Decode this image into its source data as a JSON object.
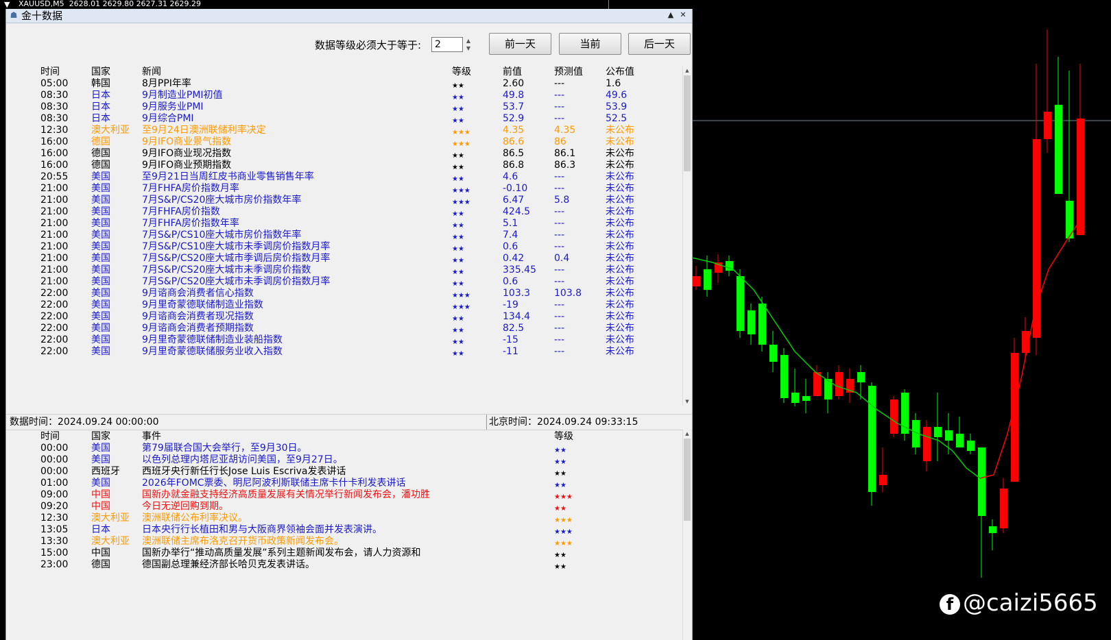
{
  "topbar": {
    "symbol_line": "XAUUSD,M5  2628.01 2629.80 2627.31 2629.29"
  },
  "window": {
    "title": "金十数据",
    "minimize": "▲",
    "close": "✕"
  },
  "filter": {
    "label": "数据等级必须大于等于:",
    "value": "2"
  },
  "buttons": {
    "prev": "前一天",
    "current": "当前",
    "next": "后一天"
  },
  "data_table": {
    "headers": {
      "time": "时间",
      "country": "国家",
      "news": "新闻",
      "level": "等级",
      "prev": "前值",
      "forecast": "预测值",
      "actual": "公布值"
    },
    "rows": [
      {
        "time": "05:00",
        "country": "韩国",
        "news": "8月PPI年率",
        "level": "★★",
        "prev": "2.60",
        "forecast": "---",
        "actual": "1.6",
        "color": "#000000"
      },
      {
        "time": "08:30",
        "country": "日本",
        "news": "9月制造业PMI初值",
        "level": "★★",
        "prev": "49.8",
        "forecast": "---",
        "actual": "49.6",
        "color": "#1a1acc"
      },
      {
        "time": "08:30",
        "country": "日本",
        "news": "9月服务业PMI",
        "level": "★★",
        "prev": "53.7",
        "forecast": "---",
        "actual": "53.9",
        "color": "#1a1acc"
      },
      {
        "time": "08:30",
        "country": "日本",
        "news": "9月综合PMI",
        "level": "★★",
        "prev": "52.9",
        "forecast": "---",
        "actual": "52.5",
        "color": "#1a1acc"
      },
      {
        "time": "12:30",
        "country": "澳大利亚",
        "news": "至9月24日澳洲联储利率决定",
        "level": "★★★",
        "prev": "4.35",
        "forecast": "4.35",
        "actual": "未公布",
        "color": "#ff9900"
      },
      {
        "time": "16:00",
        "country": "德国",
        "news": "9月IFO商业景气指数",
        "level": "★★★",
        "prev": "86.6",
        "forecast": "86",
        "actual": "未公布",
        "color": "#ff9900"
      },
      {
        "time": "16:00",
        "country": "德国",
        "news": "9月IFO商业现况指数",
        "level": "★★",
        "prev": "86.5",
        "forecast": "86.1",
        "actual": "未公布",
        "color": "#000000"
      },
      {
        "time": "16:00",
        "country": "德国",
        "news": "9月IFO商业预期指数",
        "level": "★★",
        "prev": "86.8",
        "forecast": "86.3",
        "actual": "未公布",
        "color": "#000000"
      },
      {
        "time": "20:55",
        "country": "美国",
        "news": "至9月21日当周红皮书商业零售销售年率",
        "level": "★★",
        "prev": "4.6",
        "forecast": "---",
        "actual": "未公布",
        "color": "#1a1acc"
      },
      {
        "time": "21:00",
        "country": "美国",
        "news": "7月FHFA房价指数月率",
        "level": "★★★",
        "prev": "-0.10",
        "forecast": "---",
        "actual": "未公布",
        "color": "#1a1acc"
      },
      {
        "time": "21:00",
        "country": "美国",
        "news": "7月S&P/CS20座大城市房价指数年率",
        "level": "★★★",
        "prev": "6.47",
        "forecast": "5.8",
        "actual": "未公布",
        "color": "#1a1acc"
      },
      {
        "time": "21:00",
        "country": "美国",
        "news": "7月FHFA房价指数",
        "level": "★★",
        "prev": "424.5",
        "forecast": "---",
        "actual": "未公布",
        "color": "#1a1acc"
      },
      {
        "time": "21:00",
        "country": "美国",
        "news": "7月FHFA房价指数年率",
        "level": "★★",
        "prev": "5.1",
        "forecast": "---",
        "actual": "未公布",
        "color": "#1a1acc"
      },
      {
        "time": "21:00",
        "country": "美国",
        "news": "7月S&P/CS10座大城市房价指数年率",
        "level": "★★",
        "prev": "7.4",
        "forecast": "---",
        "actual": "未公布",
        "color": "#1a1acc"
      },
      {
        "time": "21:00",
        "country": "美国",
        "news": "7月S&P/CS10座大城市未季调房价指数月率",
        "level": "★★",
        "prev": "0.6",
        "forecast": "---",
        "actual": "未公布",
        "color": "#1a1acc"
      },
      {
        "time": "21:00",
        "country": "美国",
        "news": "7月S&P/CS20座大城市季调后房价指数月率",
        "level": "★★",
        "prev": "0.42",
        "forecast": "0.4",
        "actual": "未公布",
        "color": "#1a1acc"
      },
      {
        "time": "21:00",
        "country": "美国",
        "news": "7月S&P/CS20座大城市未季调房价指数",
        "level": "★★",
        "prev": "335.45",
        "forecast": "---",
        "actual": "未公布",
        "color": "#1a1acc"
      },
      {
        "time": "21:00",
        "country": "美国",
        "news": "7月S&P/CS20座大城市未季调房价指数月率",
        "level": "★★",
        "prev": "0.6",
        "forecast": "---",
        "actual": "未公布",
        "color": "#1a1acc"
      },
      {
        "time": "22:00",
        "country": "美国",
        "news": "9月谘商会消费者信心指数",
        "level": "★★★",
        "prev": "103.3",
        "forecast": "103.8",
        "actual": "未公布",
        "color": "#1a1acc"
      },
      {
        "time": "22:00",
        "country": "美国",
        "news": "9月里奇蒙德联储制造业指数",
        "level": "★★★",
        "prev": "-19",
        "forecast": "---",
        "actual": "未公布",
        "color": "#1a1acc"
      },
      {
        "time": "22:00",
        "country": "美国",
        "news": "9月谘商会消费者现况指数",
        "level": "★★",
        "prev": "134.4",
        "forecast": "---",
        "actual": "未公布",
        "color": "#1a1acc"
      },
      {
        "time": "22:00",
        "country": "美国",
        "news": "9月谘商会消费者预期指数",
        "level": "★★",
        "prev": "82.5",
        "forecast": "---",
        "actual": "未公布",
        "color": "#1a1acc"
      },
      {
        "time": "22:00",
        "country": "美国",
        "news": "9月里奇蒙德联储制造业装船指数",
        "level": "★★",
        "prev": "-15",
        "forecast": "---",
        "actual": "未公布",
        "color": "#1a1acc"
      },
      {
        "time": "22:00",
        "country": "美国",
        "news": "9月里奇蒙德联储服务业收入指数",
        "level": "★★",
        "prev": "-11",
        "forecast": "---",
        "actual": "未公布",
        "color": "#1a1acc"
      }
    ]
  },
  "status": {
    "data_time_label": "数据时间：2024.09.24 00:00:00",
    "beijing_time_label": "北京时间：2024.09.24 09:33:15"
  },
  "event_table": {
    "headers": {
      "time": "时间",
      "country": "国家",
      "event": "事件",
      "level": "等级"
    },
    "rows": [
      {
        "time": "00:00",
        "country": "美国",
        "event": "第79届联合国大会举行，至9月30日。",
        "level": "★★",
        "color": "#1a1acc"
      },
      {
        "time": "00:00",
        "country": "美国",
        "event": "以色列总理内塔尼亚胡访问美国，至9月27日。",
        "level": "★★",
        "color": "#1a1acc"
      },
      {
        "time": "00:00",
        "country": "西班牙",
        "event": "西班牙央行新任行长Jose Luis Escriva发表讲话",
        "level": "★★",
        "color": "#000000"
      },
      {
        "time": "01:00",
        "country": "美国",
        "event": "2026年FOMC票委、明尼阿波利斯联储主席卡什卡利发表讲话",
        "level": "★★",
        "color": "#1a1acc"
      },
      {
        "time": "09:00",
        "country": "中国",
        "event": "国新办就金融支持经济高质量发展有关情况举行新闻发布会，潘功胜",
        "level": "★★★",
        "color": "#ee1111"
      },
      {
        "time": "09:20",
        "country": "中国",
        "event": "今日无逆回购到期。",
        "level": "★★",
        "color": "#ee1111"
      },
      {
        "time": "12:30",
        "country": "澳大利亚",
        "event": "澳洲联储公布利率决议。",
        "level": "★★★",
        "color": "#ff9900"
      },
      {
        "time": "13:05",
        "country": "日本",
        "event": "日本央行行长植田和男与大阪商界领袖会面并发表演讲。",
        "level": "★★★",
        "color": "#1a1acc"
      },
      {
        "time": "13:30",
        "country": "澳大利亚",
        "event": "澳洲联储主席布洛克召开货币政策新闻发布会。",
        "level": "★★★",
        "color": "#ff9900"
      },
      {
        "time": "15:00",
        "country": "中国",
        "event": "国新办举行“推动高质量发展”系列主题新闻发布会，请人力资源和",
        "level": "★★",
        "color": "#000000"
      },
      {
        "time": "23:00",
        "country": "德国",
        "event": "德国副总理兼经济部长哈贝克发表讲话。",
        "level": "★★",
        "color": "#000000"
      }
    ]
  },
  "watermark": {
    "icon": "facebook-icon",
    "handle": "@caizi5665"
  },
  "chart_colors": {
    "bull": "#00ff00",
    "bear": "#ff0000",
    "ma_up": "#ff0000",
    "ma_down": "#00cc00",
    "price_line": "#778899"
  }
}
